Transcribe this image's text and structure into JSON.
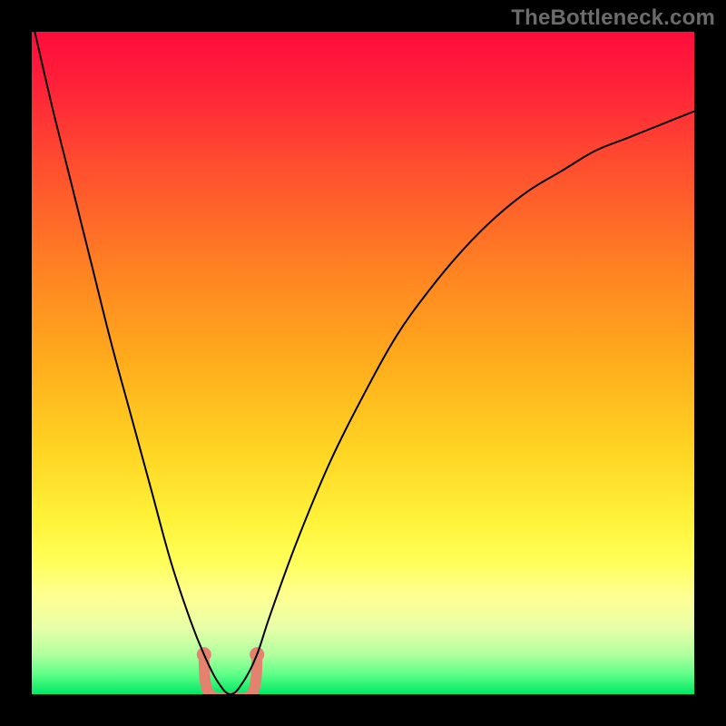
{
  "watermark": "TheBottleneck.com",
  "chart_data": {
    "type": "line",
    "title": "",
    "xlabel": "",
    "ylabel": "",
    "xlim": [
      0,
      100
    ],
    "ylim": [
      0,
      100
    ],
    "grid": false,
    "legend": false,
    "annotations": [],
    "series": [
      {
        "name": "bottleneck-curve",
        "x": [
          0,
          3,
          6,
          9,
          12,
          15,
          18,
          21,
          24,
          26,
          28,
          30,
          32,
          34,
          36,
          40,
          45,
          50,
          55,
          60,
          65,
          70,
          75,
          80,
          85,
          90,
          95,
          100
        ],
        "y": [
          102,
          89,
          77,
          65,
          53,
          42,
          31,
          20,
          11,
          6,
          2,
          0,
          2,
          6,
          12,
          23,
          35,
          45,
          54,
          61,
          67,
          72,
          76,
          79,
          82,
          84,
          86,
          88
        ]
      }
    ],
    "min_marker": {
      "x_range": [
        26,
        34
      ],
      "y_range": [
        0,
        6
      ],
      "color": "#e2826f"
    },
    "background_gradient": {
      "stops": [
        {
          "offset": 0.0,
          "color": "#ff0d3c"
        },
        {
          "offset": 0.07,
          "color": "#ff1e3a"
        },
        {
          "offset": 0.2,
          "color": "#ff4d2f"
        },
        {
          "offset": 0.35,
          "color": "#ff7f23"
        },
        {
          "offset": 0.5,
          "color": "#ffad1c"
        },
        {
          "offset": 0.63,
          "color": "#ffd423"
        },
        {
          "offset": 0.74,
          "color": "#fff33a"
        },
        {
          "offset": 0.8,
          "color": "#ffff5a"
        },
        {
          "offset": 0.85,
          "color": "#ffff90"
        },
        {
          "offset": 0.9,
          "color": "#e7ffa8"
        },
        {
          "offset": 0.94,
          "color": "#b0ff9e"
        },
        {
          "offset": 0.97,
          "color": "#5eff88"
        },
        {
          "offset": 1.0,
          "color": "#00e765"
        }
      ]
    }
  }
}
